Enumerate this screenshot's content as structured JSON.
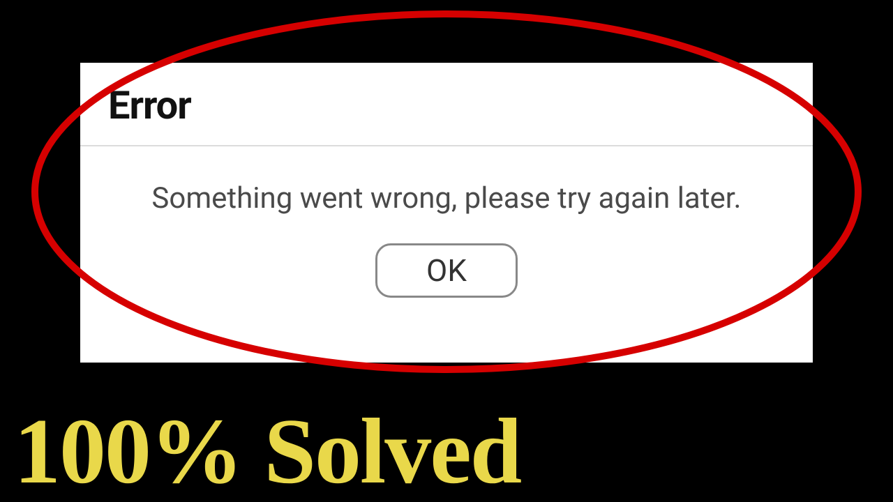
{
  "dialog": {
    "title": "Error",
    "message": "Something went wrong, please try again later.",
    "ok_label": "OK"
  },
  "caption": "100% Solved",
  "colors": {
    "background": "#000000",
    "dialog_bg": "#ffffff",
    "ellipse_stroke": "#d60000",
    "caption_color": "#e9d84a"
  }
}
